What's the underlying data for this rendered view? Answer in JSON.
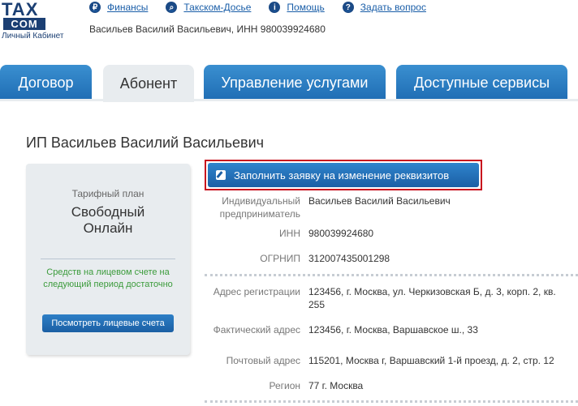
{
  "header": {
    "logo_top": "TAX",
    "logo_bottom": "COM",
    "logo_sub": "Личный Кабинет",
    "nav": [
      {
        "label": "Финансы",
        "icon": "ruble-icon",
        "glyph": "₽"
      },
      {
        "label": "Такском-Досье",
        "icon": "search-icon",
        "glyph": "⌕"
      },
      {
        "label": "Помощь",
        "icon": "info-icon",
        "glyph": "i"
      },
      {
        "label": "Задать вопрос",
        "icon": "question-icon",
        "glyph": "?"
      }
    ],
    "user_name": "Васильев Василий Васильевич,",
    "inn_label": "ИНН",
    "inn_value": "980039924680"
  },
  "tabs": [
    {
      "label": "Договор",
      "active": false
    },
    {
      "label": "Абонент",
      "active": true
    },
    {
      "label": "Управление услугами",
      "active": false
    },
    {
      "label": "Доступные сервисы",
      "active": false
    }
  ],
  "main": {
    "title": "ИП Васильев Василий Васильевич",
    "plan": {
      "label": "Тарифный план",
      "name_line1": "Свободный",
      "name_line2": "Онлайн",
      "note": "Средств на лицевом счете на следующий период достаточно",
      "button": "Посмотреть лицевые счета"
    },
    "request_button": "Заполнить заявку на изменение реквизитов",
    "details": [
      {
        "key": "Индивидуальный предприниматель",
        "value": "Васильев Василий Васильевич"
      },
      {
        "key": "ИНН",
        "value": "980039924680"
      },
      {
        "key": "ОГРНИП",
        "value": "312007435001298"
      },
      {
        "key": "Адрес регистрации",
        "value": "123456, г. Москва, ул. Черкизовская Б, д. 3, корп. 2, кв. 255"
      },
      {
        "key": "Фактический адрес",
        "value": "123456, г. Москва, Варшавское ш., 33"
      },
      {
        "key": "Почтовый адрес",
        "value": "115201, Москва г, Варшавский 1-й проезд, д. 2, стр. 12"
      },
      {
        "key": "Регион",
        "value": "77 г. Москва"
      }
    ]
  },
  "colors": {
    "tab_blue": "#1f6db4",
    "highlight_red": "#c8101d",
    "note_green": "#3b9b3b"
  }
}
